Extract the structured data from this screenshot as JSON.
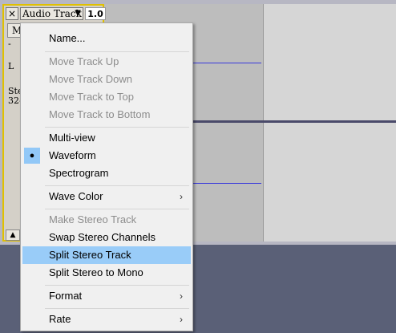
{
  "track": {
    "close_glyph": "×",
    "name": "Audio Track",
    "dropdown_glyph": "▼",
    "gain": "1.0",
    "mute_label": "M",
    "scale_mark_1": "-",
    "scale_mark_2": "L",
    "info_line_1": "Ste",
    "info_line_2": "32-",
    "collapse_glyph": "▲"
  },
  "menu": {
    "items": [
      {
        "label": "Name...",
        "enabled": true
      },
      {
        "label": "Move Track Up",
        "enabled": false
      },
      {
        "label": "Move Track Down",
        "enabled": false
      },
      {
        "label": "Move Track to Top",
        "enabled": false
      },
      {
        "label": "Move Track to Bottom",
        "enabled": false
      },
      {
        "label": "Multi-view",
        "enabled": true
      },
      {
        "label": "Waveform",
        "enabled": true,
        "checked": true,
        "check_glyph": "●"
      },
      {
        "label": "Spectrogram",
        "enabled": true
      },
      {
        "label": "Wave Color",
        "enabled": true,
        "submenu": true
      },
      {
        "label": "Make Stereo Track",
        "enabled": false
      },
      {
        "label": "Swap Stereo Channels",
        "enabled": true
      },
      {
        "label": "Split Stereo Track",
        "enabled": true,
        "highlighted": true
      },
      {
        "label": "Split Stereo to Mono",
        "enabled": true
      },
      {
        "label": "Format",
        "enabled": true,
        "submenu": true
      },
      {
        "label": "Rate",
        "enabled": true,
        "submenu": true
      }
    ],
    "submenu_glyph": "›"
  },
  "colors": {
    "highlight": "#99ccf8",
    "track_border": "#e0c000",
    "waveform": "#3a3adb",
    "background": "#5a6077"
  }
}
